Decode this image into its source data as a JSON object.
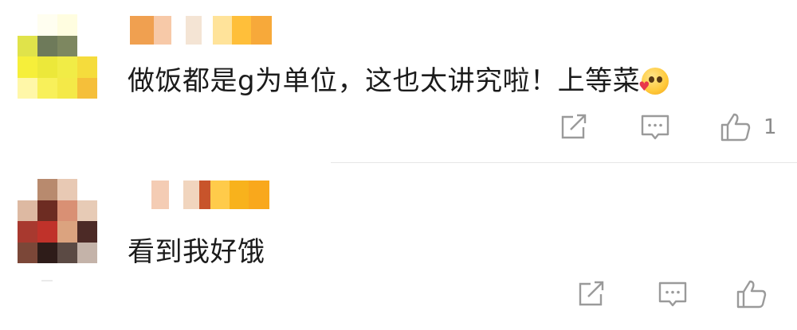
{
  "comments": [
    {
      "text": "做饭都是g为单位，这也太讲究啦！上等菜",
      "emoji": "heart-eyes-face-icon",
      "like_count": "1",
      "avatar_colors": [
        "#ffffff",
        "#fffef0",
        "#fffde0",
        "#ffffff",
        "#e0e34a",
        "#6e7a5a",
        "#7d8760",
        "#ffffff",
        "#f6ef3a",
        "#ece83a",
        "#f1ec46",
        "#f5dc3c",
        "#fff7a8",
        "#f8f05a",
        "#f4e948",
        "#f5bf3a"
      ],
      "name_colors": [
        "#f0a050",
        "#f7c9a8",
        "#ffffff",
        "#f4e4d4",
        "#ffffff",
        "#ffe39a",
        "#ffbf3a",
        "#f7a93a"
      ]
    },
    {
      "text": "看到我好饿",
      "like_count": "",
      "avatar_colors": [
        "#ffffff",
        "#b88a6e",
        "#e8c9b4",
        "#ffffff",
        "#ddb9a2",
        "#6d2c22",
        "#d99074",
        "#e7cbb6",
        "#a8392f",
        "#c0322a",
        "#dba37f",
        "#4c2a26",
        "#7b4738",
        "#2e1c19",
        "#5b4a44",
        "#c4b3a9"
      ],
      "name_colors": [
        "#ffffff",
        "#f4ccb4",
        "#ffffff",
        "#f1d5be",
        "#c8542b",
        "#ffcb4a",
        "#f8b21c",
        "#f9a81c"
      ]
    }
  ]
}
